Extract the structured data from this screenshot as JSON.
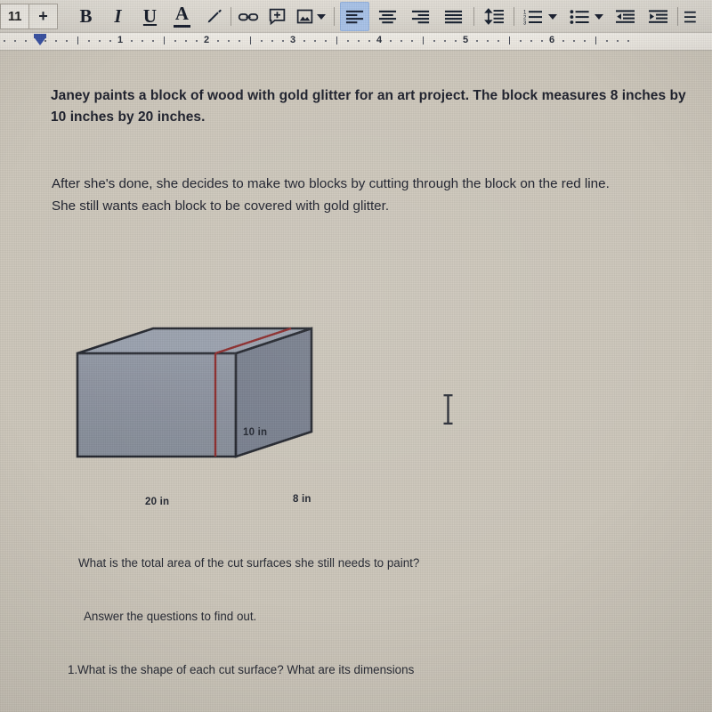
{
  "toolbar": {
    "font_size": "11",
    "increase_font_label": "+",
    "bold_label": "B",
    "italic_label": "I",
    "underline_label": "U",
    "text_color_label": "A",
    "highlight_icon": "pen-highlight-icon",
    "link_icon": "link-icon",
    "comment_icon": "add-comment-icon",
    "image_icon": "insert-image-icon",
    "align_left_icon": "align-left-icon",
    "align_center_icon": "align-center-icon",
    "align_right_icon": "align-right-icon",
    "align_justify_icon": "align-justify-icon",
    "line_spacing_icon": "line-spacing-icon",
    "numbered_list_icon": "numbered-list-icon",
    "bulleted_list_icon": "bulleted-list-icon",
    "decrease_indent_icon": "decrease-indent-icon",
    "increase_indent_icon": "increase-indent-icon",
    "active_alignment": "left",
    "accent_color": "#a9c3e8"
  },
  "ruler": {
    "marks": [
      "1",
      "2",
      "3",
      "4",
      "5",
      "6"
    ],
    "indent_marker": "left-indent-marker"
  },
  "document": {
    "paragraph_1": "Janey paints a block of wood with gold glitter for an art project. The block measures 8 inches by 10 inches by 20 inches.",
    "paragraph_2_line_1": "After she's done, she decides to make two blocks by cutting through the block on the red line.",
    "paragraph_2_line_2": "She still wants each block to be covered with gold glitter.",
    "question_main": "What is the total area of the cut surfaces she still needs to paint?",
    "instruction": "Answer the questions to find out.",
    "question_1": "1.What is the shape of each cut surface? What are its dimensions",
    "page_color": "#cdc7bb",
    "text_color": "#1c1f2b"
  },
  "figure": {
    "name": "rectangular-prism-diagram",
    "label_length": "20 in",
    "label_height": "10 in",
    "label_depth": "8 in",
    "cut_line_color": "#8c2a2a",
    "front_face_color": "#8b92a0",
    "top_face_color": "#9ba2af",
    "side_face_color": "#79808f",
    "edge_color": "#23262e"
  },
  "cursor": {
    "type": "i-beam-text-cursor"
  }
}
